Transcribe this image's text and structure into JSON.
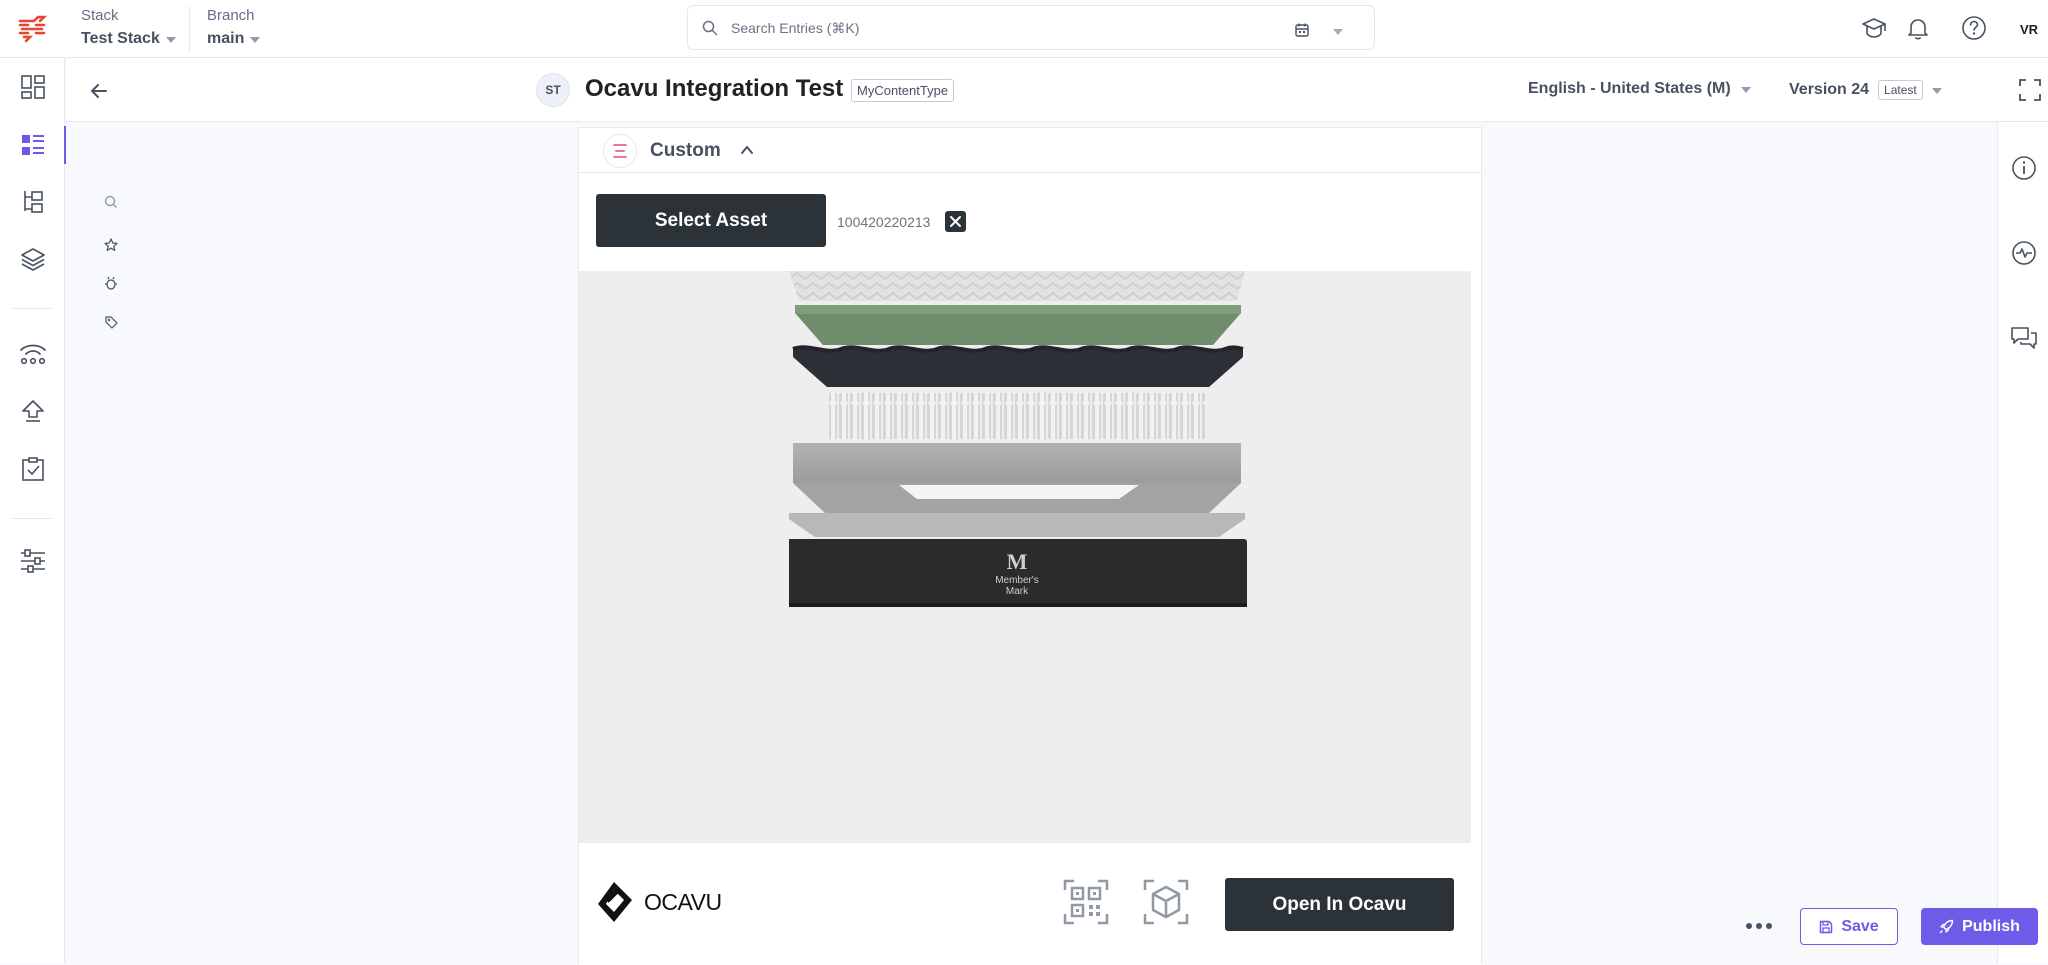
{
  "topbar": {
    "stack_label": "Stack",
    "stack_value": "Test Stack",
    "branch_label": "Branch",
    "branch_value": "main",
    "search_placeholder": "Search Entries (⌘K)",
    "user_initials": "VR"
  },
  "entry": {
    "avatar_initials": "ST",
    "title": "Ocavu Integration Test",
    "content_type": "MyContentType",
    "locale": "English - United States (M)",
    "version": "Version 24",
    "version_badge": "Latest"
  },
  "field": {
    "title": "Custom",
    "select_asset_label": "Select Asset",
    "asset_id": "100420220213",
    "viewer_brand_line1": "Member's",
    "viewer_brand_line2": "Mark",
    "viewer_brand_mark": "M",
    "ocavu_logo_text": "OCAVU",
    "open_button_label": "Open In Ocavu"
  },
  "actions": {
    "save_label": "Save",
    "publish_label": "Publish"
  },
  "colors": {
    "accent": "#6c5ce7",
    "dark_button": "#2b3238",
    "nav_icon": "#475161",
    "active_nav": "#6c5ce7"
  }
}
